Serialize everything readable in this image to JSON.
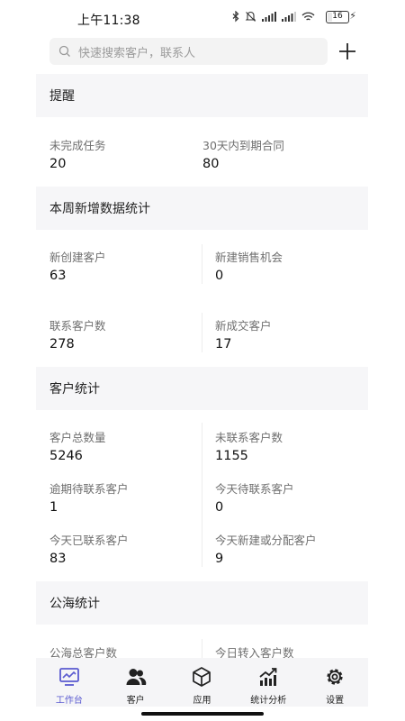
{
  "status_bar": {
    "time": "上午11:38",
    "battery": "16"
  },
  "search": {
    "placeholder": "快速搜索客户，联系人"
  },
  "sections": {
    "reminder": {
      "title": "提醒",
      "items": [
        {
          "label": "未完成任务",
          "value": "20"
        },
        {
          "label": "30天内到期合同",
          "value": "80"
        }
      ]
    },
    "weekly": {
      "title": "本周新增数据统计",
      "items": [
        {
          "label": "新创建客户",
          "value": "63"
        },
        {
          "label": "新建销售机会",
          "value": "0"
        },
        {
          "label": "联系客户数",
          "value": "278"
        },
        {
          "label": "新成交客户",
          "value": "17"
        }
      ]
    },
    "customers": {
      "title": "客户统计",
      "items": [
        {
          "label": "客户总数量",
          "value": "5246"
        },
        {
          "label": "未联系客户数",
          "value": "1155"
        },
        {
          "label": "逾期待联系客户",
          "value": "1"
        },
        {
          "label": "今天待联系客户",
          "value": "0"
        },
        {
          "label": "今天已联系客户",
          "value": "83"
        },
        {
          "label": "今天新建或分配客户",
          "value": "9"
        }
      ]
    },
    "pool": {
      "title": "公海统计",
      "items": [
        {
          "label": "公海总客户数"
        },
        {
          "label": "今日转入客户数"
        }
      ]
    }
  },
  "nav": {
    "items": [
      {
        "label": "工作台",
        "icon": "dashboard-icon",
        "active": true
      },
      {
        "label": "客户",
        "icon": "customers-icon"
      },
      {
        "label": "应用",
        "icon": "cube-icon"
      },
      {
        "label": "统计分析",
        "icon": "chart-icon"
      },
      {
        "label": "设置",
        "icon": "gear-icon"
      }
    ]
  },
  "colors": {
    "accent": "#5a5ad0",
    "section_bg": "#f6f6f8",
    "label": "#6f6f6f"
  }
}
